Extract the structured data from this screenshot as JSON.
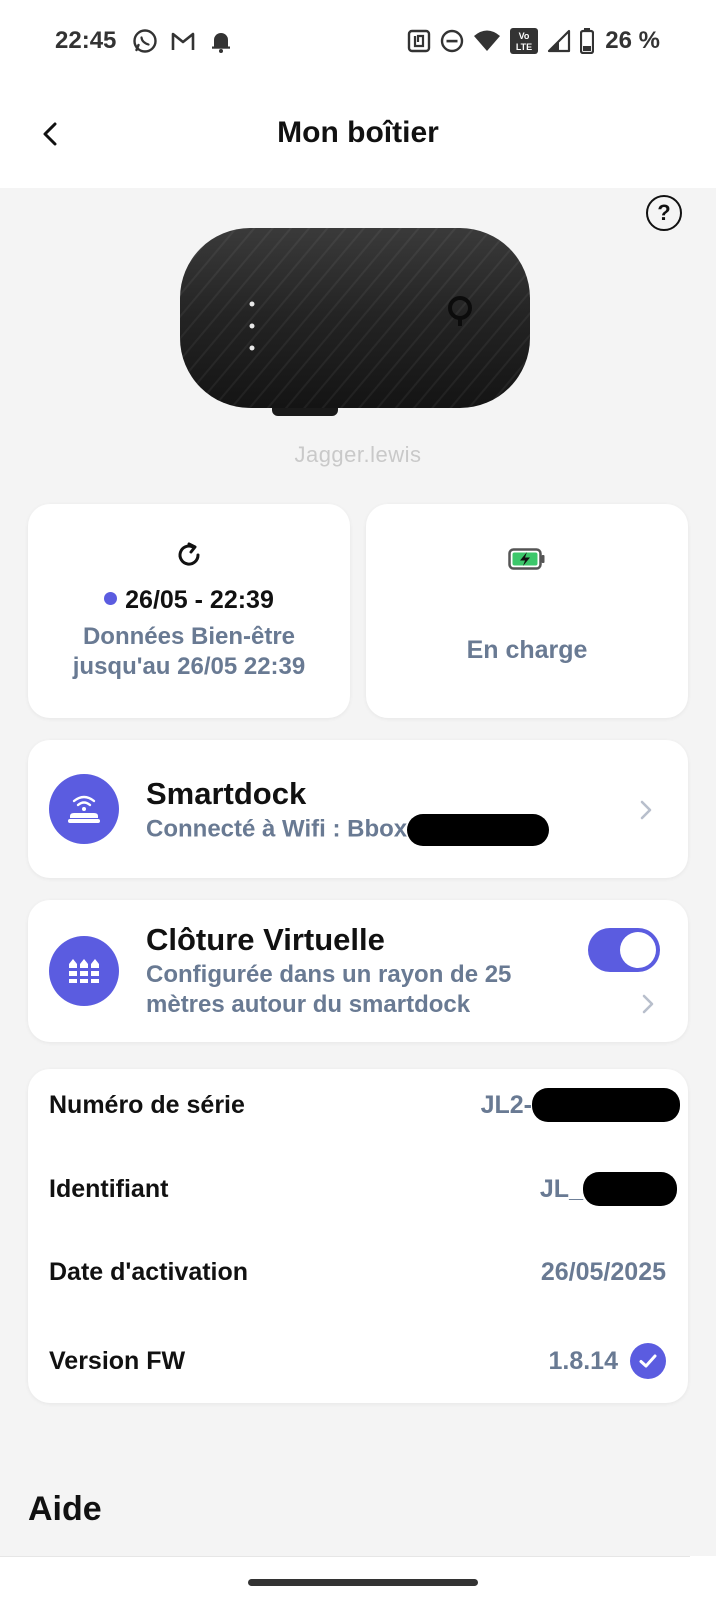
{
  "status_bar": {
    "time": "22:45",
    "battery_percent": "26 %",
    "left_icons": [
      "whatsapp-icon",
      "gmail-icon",
      "notification-bell-icon"
    ],
    "right_icons": [
      "nfc-icon",
      "do-not-disturb-icon",
      "wifi-icon",
      "volte-icon",
      "signal-icon",
      "battery-icon"
    ]
  },
  "header": {
    "title": "Mon boîtier",
    "back_icon": "chevron-left-icon"
  },
  "device": {
    "brand_label": "Jagger.lewis",
    "help_label": "?"
  },
  "sync": {
    "icon": "refresh-icon",
    "date": "26/05 - 22:39",
    "status_dot_color": "#5b5ce0",
    "description": "Données Bien-être jusqu'au 26/05 22:39"
  },
  "battery": {
    "icon": "battery-charging-icon",
    "label": "En charge"
  },
  "smartdock": {
    "title": "Smartdock",
    "subtitle": "Connecté à Wifi : Bbox"
  },
  "fence": {
    "title": "Clôture Virtuelle",
    "subtitle": "Configurée dans un rayon de 25 mètres autour du smartdock",
    "enabled": true
  },
  "info": {
    "serial_label": "Numéro de série",
    "serial_value": "JL2-",
    "id_label": "Identifiant",
    "id_value": "JL_",
    "activation_label": "Date d'activation",
    "activation_value": "26/05/2025",
    "fw_label": "Version FW",
    "fw_value": "1.8.14"
  },
  "aide": {
    "title": "Aide"
  },
  "colors": {
    "accent": "#5b5ce0",
    "muted_text": "#697a93",
    "background": "#f4f4f4"
  }
}
